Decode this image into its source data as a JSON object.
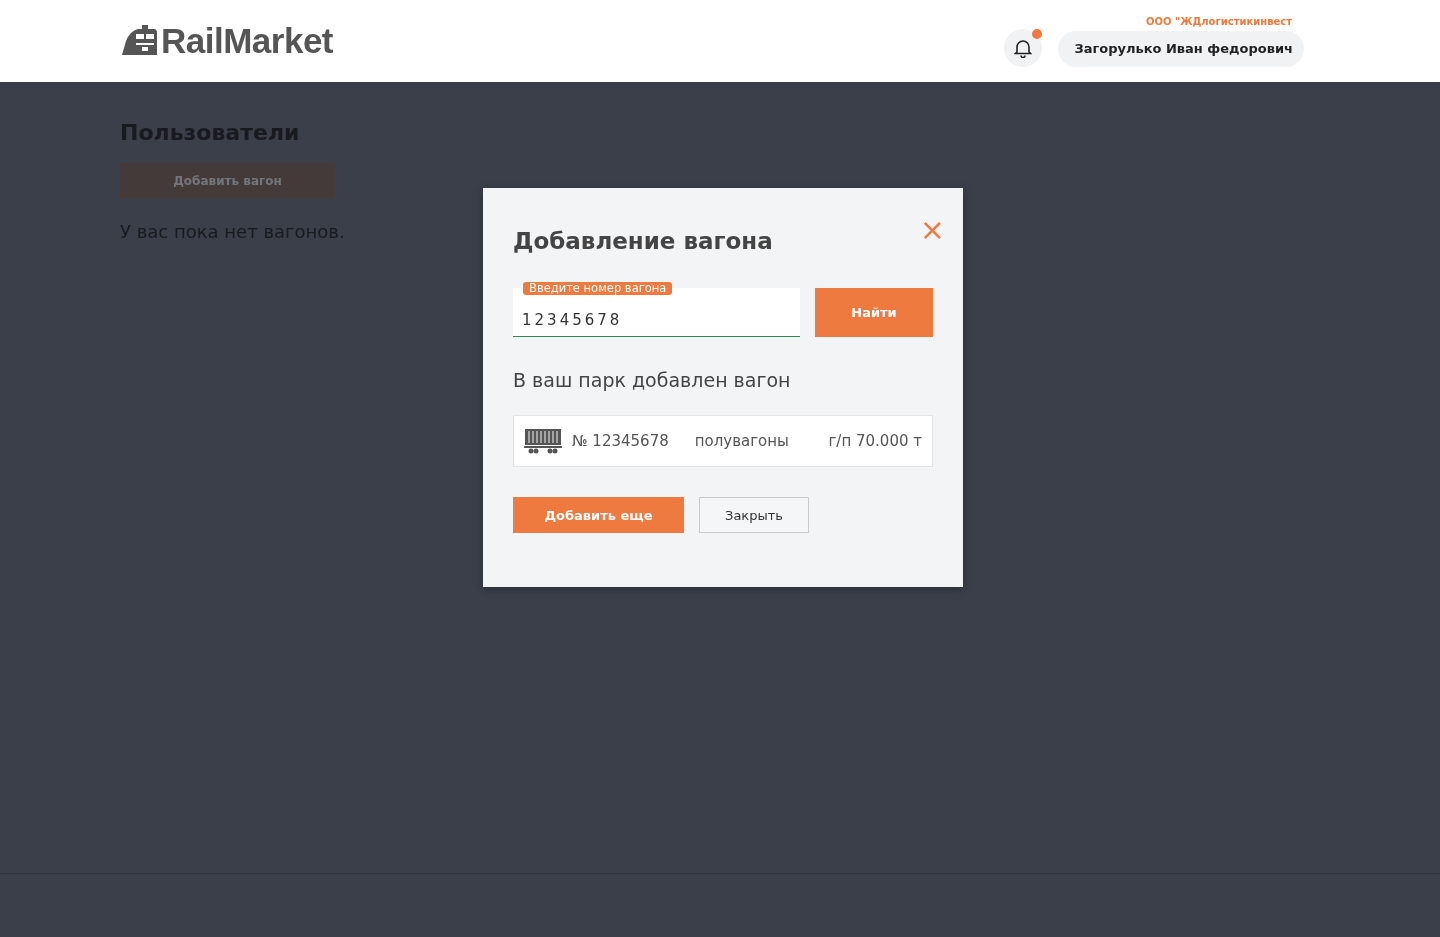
{
  "header": {
    "logo": "RailMarket",
    "notifications": {
      "unread": true
    },
    "company": "ООО \"ЖДлогистикинвест",
    "user": "Загорулько Иван федорович"
  },
  "page": {
    "title": "Пользователи",
    "add_button": "Добавить вагон",
    "empty_text": "У вас пока нет вагонов."
  },
  "modal": {
    "title": "Добавление вагона",
    "close": "×",
    "field": {
      "label": "Введите номер вагона",
      "value": "12345678"
    },
    "search_button": "Найти",
    "result_title": "В ваш парк добавлен  вагон",
    "wagon": {
      "number": "№ 12345678",
      "type": "полувагоны",
      "capacity": "г/п 70.000 т"
    },
    "buttons": [
      {
        "label": "Добавить еще",
        "kind": "primary"
      },
      {
        "label": "Закрыть",
        "kind": "secondary"
      }
    ]
  }
}
